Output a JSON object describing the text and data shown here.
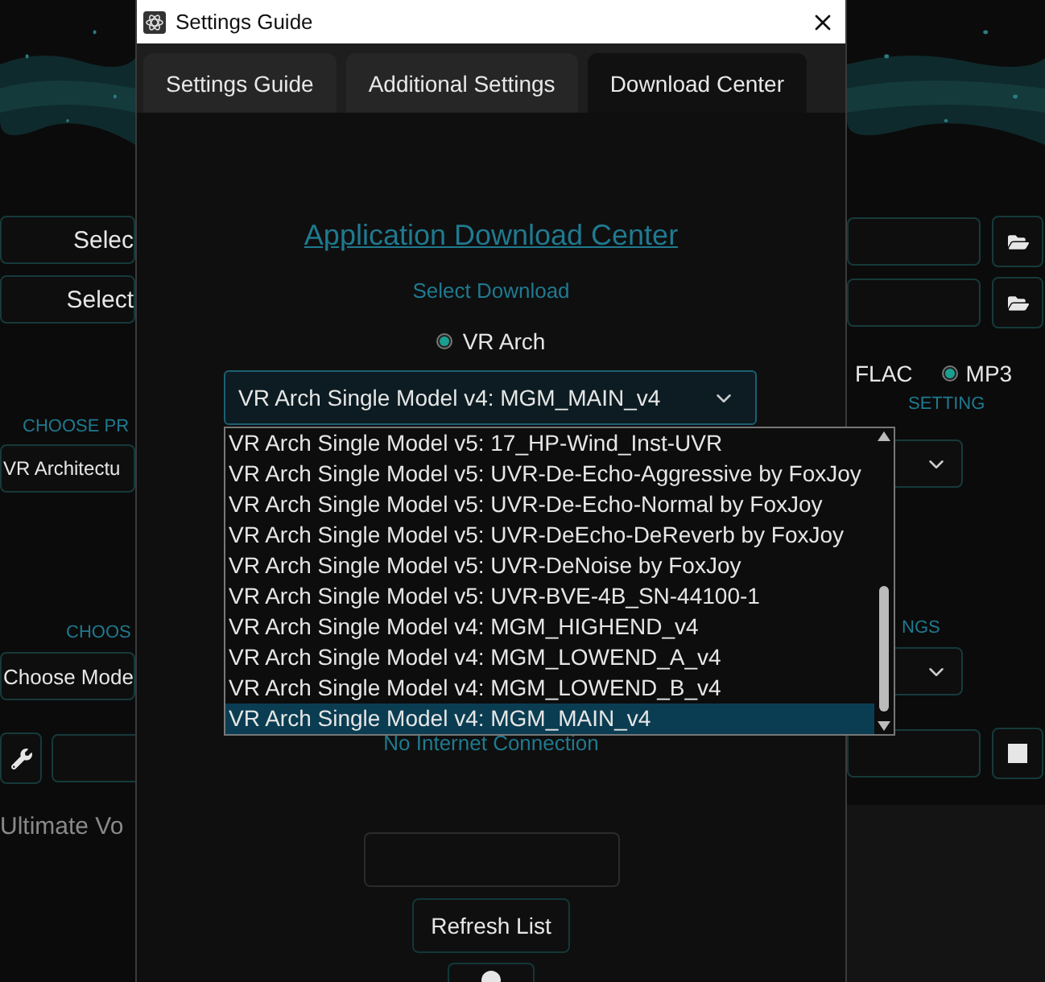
{
  "background_left": {
    "path_buttons": [
      "Selec",
      "Select"
    ],
    "section_label_1": "CHOOSE PR",
    "select_1": "VR Architectu",
    "section_label_2": "CHOOS",
    "select_2": "Choose Mode",
    "footer_text": "Ultimate Vo"
  },
  "background_right": {
    "flac_label": "FLAC",
    "mp3_option": {
      "label": "MP3",
      "selected": true
    },
    "section_label_1": "SETTING",
    "section_label_2": "NGS"
  },
  "dialog": {
    "title": "Settings Guide",
    "tabs": [
      {
        "label": "Settings Guide",
        "selected": false
      },
      {
        "label": "Additional Settings",
        "selected": false
      },
      {
        "label": "Download Center",
        "selected": true
      }
    ],
    "heading": "Application Download Center",
    "select_label": "Select Download",
    "arch_option": {
      "label": "VR Arch",
      "selected": true
    },
    "model_select": {
      "value": "VR Arch Single Model v4: MGM_MAIN_v4",
      "expanded": true
    },
    "model_options": [
      {
        "label": "VR Arch Single Model v5: 17_HP-Wind_Inst-UVR",
        "selected": false
      },
      {
        "label": "VR Arch Single Model v5: UVR-De-Echo-Aggressive by FoxJoy",
        "selected": false
      },
      {
        "label": "VR Arch Single Model v5: UVR-De-Echo-Normal by FoxJoy",
        "selected": false
      },
      {
        "label": "VR Arch Single Model v5: UVR-DeEcho-DeReverb by FoxJoy",
        "selected": false
      },
      {
        "label": "VR Arch Single Model v5: UVR-DeNoise by FoxJoy",
        "selected": false
      },
      {
        "label": "VR Arch Single Model v5: UVR-BVE-4B_SN-44100-1",
        "selected": false
      },
      {
        "label": "VR Arch Single Model v4: MGM_HIGHEND_v4",
        "selected": false
      },
      {
        "label": "VR Arch Single Model v4: MGM_LOWEND_A_v4",
        "selected": false
      },
      {
        "label": "VR Arch Single Model v4: MGM_LOWEND_B_v4",
        "selected": false
      },
      {
        "label": "VR Arch Single Model v4: MGM_MAIN_v4",
        "selected": true
      }
    ],
    "status": "No Internet Connection",
    "refresh_button": "Refresh List"
  }
}
